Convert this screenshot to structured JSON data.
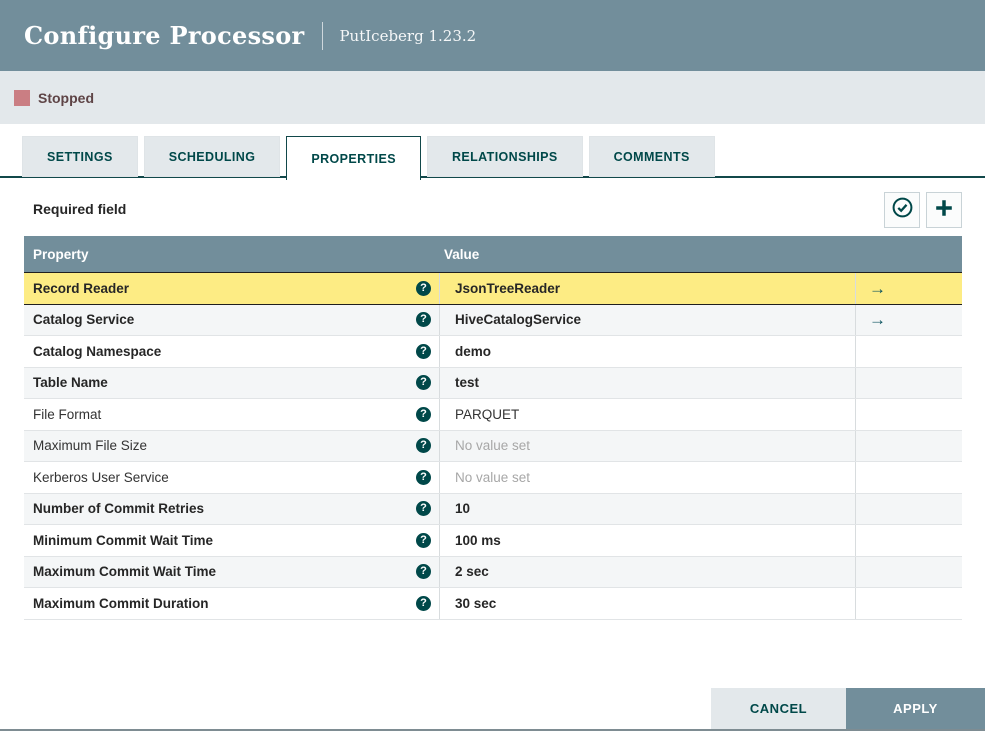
{
  "header": {
    "title": "Configure Processor",
    "subtitle": "PutIceberg 1.23.2"
  },
  "status": {
    "label": "Stopped"
  },
  "tabs": [
    {
      "label": "SETTINGS",
      "active": false
    },
    {
      "label": "SCHEDULING",
      "active": false
    },
    {
      "label": "PROPERTIES",
      "active": true
    },
    {
      "label": "RELATIONSHIPS",
      "active": false
    },
    {
      "label": "COMMENTS",
      "active": false
    }
  ],
  "toolbar": {
    "required_label": "Required field",
    "verify_icon": "check-circle-icon",
    "add_icon": "plus-icon"
  },
  "table": {
    "columns": [
      "Property",
      "Value"
    ],
    "help_glyph": "?",
    "goto_glyph": "→",
    "rows": [
      {
        "property": "Record Reader",
        "value": "JsonTreeReader",
        "required": true,
        "selected": true,
        "goto": true
      },
      {
        "property": "Catalog Service",
        "value": "HiveCatalogService",
        "required": true,
        "selected": false,
        "goto": true
      },
      {
        "property": "Catalog Namespace",
        "value": "demo",
        "required": true,
        "selected": false,
        "goto": false
      },
      {
        "property": "Table Name",
        "value": "test",
        "required": true,
        "selected": false,
        "goto": false
      },
      {
        "property": "File Format",
        "value": "PARQUET",
        "required": false,
        "selected": false,
        "goto": false
      },
      {
        "property": "Maximum File Size",
        "value": null,
        "required": false,
        "selected": false,
        "goto": false
      },
      {
        "property": "Kerberos User Service",
        "value": null,
        "required": false,
        "selected": false,
        "goto": false
      },
      {
        "property": "Number of Commit Retries",
        "value": "10",
        "required": true,
        "selected": false,
        "goto": false
      },
      {
        "property": "Minimum Commit Wait Time",
        "value": "100 ms",
        "required": true,
        "selected": false,
        "goto": false
      },
      {
        "property": "Maximum Commit Wait Time",
        "value": "2 sec",
        "required": true,
        "selected": false,
        "goto": false
      },
      {
        "property": "Maximum Commit Duration",
        "value": "30 sec",
        "required": true,
        "selected": false,
        "goto": false
      }
    ],
    "empty_value_text": "No value set"
  },
  "footer": {
    "cancel_label": "CANCEL",
    "apply_label": "APPLY"
  },
  "colors": {
    "accent_teal": "#004849",
    "header_slate": "#728e9b",
    "status_bar_bg": "#e3e8eb",
    "stopped_red": "#ca7e83",
    "selected_row_yellow": "#fdec84",
    "alt_row": "#f4f6f7"
  }
}
